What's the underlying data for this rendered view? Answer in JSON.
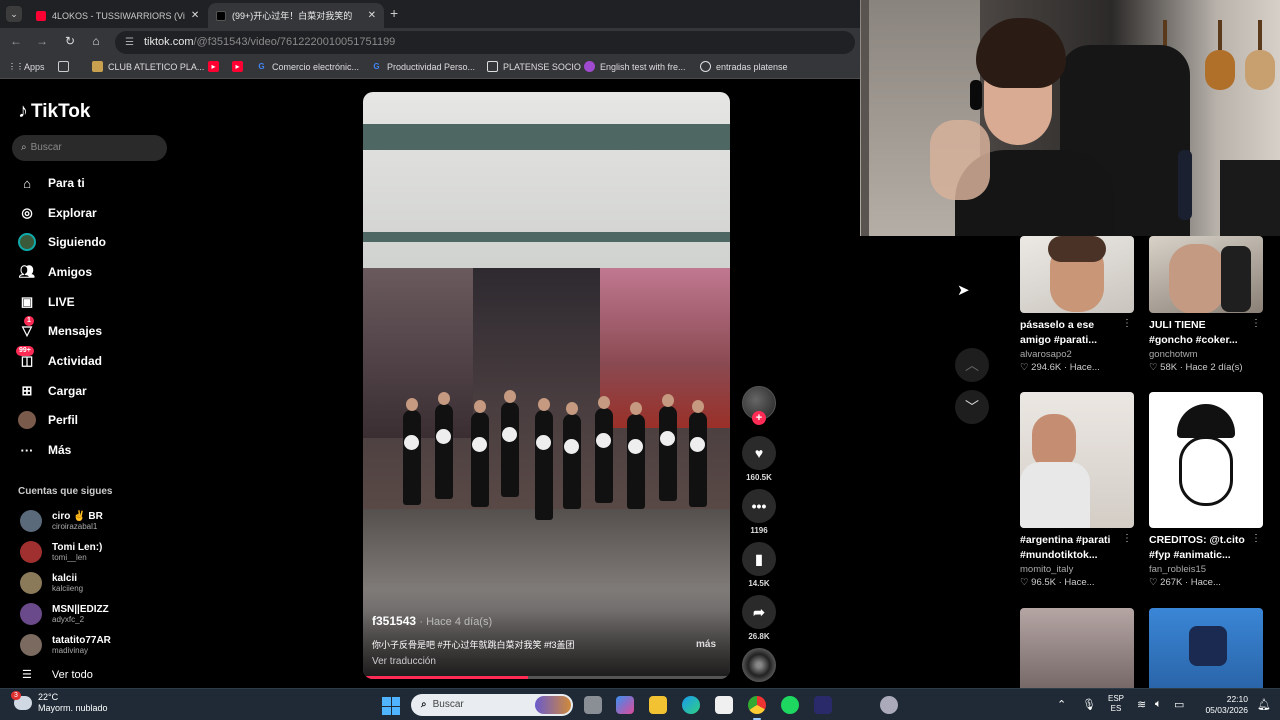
{
  "browser": {
    "tabs": [
      {
        "title": "4LOKOS - TUSSIWARRIORS (Vi",
        "active": false,
        "favicon_color": "#ff0033"
      },
      {
        "title": "(99+)开心过年！白菜对我笑的",
        "active": true,
        "favicon_color": "#000000"
      }
    ],
    "url_host": "tiktok.com",
    "url_path": "/@f351543/video/7612220010051751199",
    "bookmarks": [
      {
        "label": "Apps",
        "icon": "apps-grid-icon",
        "color": "#ffffff"
      },
      {
        "label": "",
        "icon": "grid-icon",
        "color": "#ffffff"
      },
      {
        "label": "CLUB ATLETICO PLA...",
        "icon": "club-crest-icon",
        "color": "#c8a050"
      },
      {
        "label": "",
        "icon": "youtube-icon",
        "color": "#ff0033"
      },
      {
        "label": "",
        "icon": "youtube-icon",
        "color": "#ff0033"
      },
      {
        "label": "Comercio electrónic...",
        "icon": "google-icon",
        "color": "#4285f4"
      },
      {
        "label": "Productividad Perso...",
        "icon": "google-icon",
        "color": "#4285f4"
      },
      {
        "label": "PLATENSE SOCIO",
        "icon": "platense-icon",
        "color": "#ffffff"
      },
      {
        "label": "English test with fre...",
        "icon": "ef-icon",
        "color": "#a04ad0"
      },
      {
        "label": "entradas platense",
        "icon": "ticket-icon",
        "color": "#ffffff"
      }
    ]
  },
  "tiktok": {
    "logo": "TikTok",
    "search_placeholder": "Buscar",
    "nav": [
      {
        "label": "Para ti",
        "icon": "home-icon",
        "badge": ""
      },
      {
        "label": "Explorar",
        "icon": "compass-icon",
        "badge": ""
      },
      {
        "label": "Siguiendo",
        "icon": "following-avatar-icon",
        "badge": ""
      },
      {
        "label": "Amigos",
        "icon": "friends-icon",
        "badge": ""
      },
      {
        "label": "LIVE",
        "icon": "live-icon",
        "badge": ""
      },
      {
        "label": "Mensajes",
        "icon": "messages-icon",
        "badge": "1"
      },
      {
        "label": "Actividad",
        "icon": "activity-icon",
        "badge": "99+"
      },
      {
        "label": "Cargar",
        "icon": "upload-icon",
        "badge": ""
      },
      {
        "label": "Perfil",
        "icon": "profile-avatar-icon",
        "badge": ""
      },
      {
        "label": "Más",
        "icon": "more-icon",
        "badge": ""
      }
    ],
    "following_title": "Cuentas que sigues",
    "following": [
      {
        "name": "ciro ✌ BR",
        "username": "ciroirazabal1",
        "color": "#5a6a7a"
      },
      {
        "name": "Tomi Len:)",
        "username": "tomi__len",
        "color": "#a03030"
      },
      {
        "name": "kalcii",
        "username": "kalciieng",
        "color": "#8a7a5a"
      },
      {
        "name": "MSN||EDIZZ",
        "username": "adyxfc_2",
        "color": "#6a4a8a"
      },
      {
        "name": "tatatito77AR",
        "username": "madivinay",
        "color": "#7a6a60"
      }
    ],
    "see_all": "Ver todo"
  },
  "video": {
    "author": "f351543",
    "time": "· Hace 4 día(s)",
    "caption": "你小子反骨是吧 #开心过年就跳白菜对我笑 #f3盖团",
    "more": "más",
    "translate": "Ver traducción",
    "progress": 0.45,
    "likes": "160.5K",
    "comments": "1196",
    "saves": "14.5K",
    "shares": "26.8K"
  },
  "grid": [
    {
      "title": "pásaselo a ese\namigo #parati...",
      "author": "alvarosapo2",
      "stats": "♡ 294.6K · Hace...",
      "palette": [
        "#e9e6e2",
        "#7a5a4a"
      ]
    },
    {
      "title": "JULI TIENE\n#goncho #coker...",
      "author": "gonchotwm",
      "stats": "♡ 58K · Hace 2 día(s)",
      "palette": [
        "#d8d2c8",
        "#3a2c22"
      ]
    },
    {
      "title": "#argentina #parati\n#mundotiktok...",
      "author": "momito_italy",
      "stats": "♡ 96.5K · Hace...",
      "palette": [
        "#e6e1dc",
        "#b08a70"
      ]
    },
    {
      "title": "CREDITOS: @t.cito\n#fyp #animatic...",
      "author": "fan_robleis15",
      "stats": "♡ 267K · Hace...",
      "palette": [
        "#ffffff",
        "#111111"
      ]
    },
    {
      "title": "",
      "author": "",
      "stats": "",
      "palette": [
        "#9a8a88",
        "#3a3030"
      ]
    },
    {
      "title": "",
      "author": "",
      "stats": "",
      "palette": [
        "#2a6ab0",
        "#f0c020"
      ]
    }
  ],
  "taskbar": {
    "temp": "22°C",
    "weather": "Mayorm. nublado",
    "weather_badge": "3",
    "search_placeholder": "Buscar",
    "lang_top": "ESP",
    "lang_bottom": "ES",
    "time": "22:10",
    "date": "05/03/2026"
  }
}
